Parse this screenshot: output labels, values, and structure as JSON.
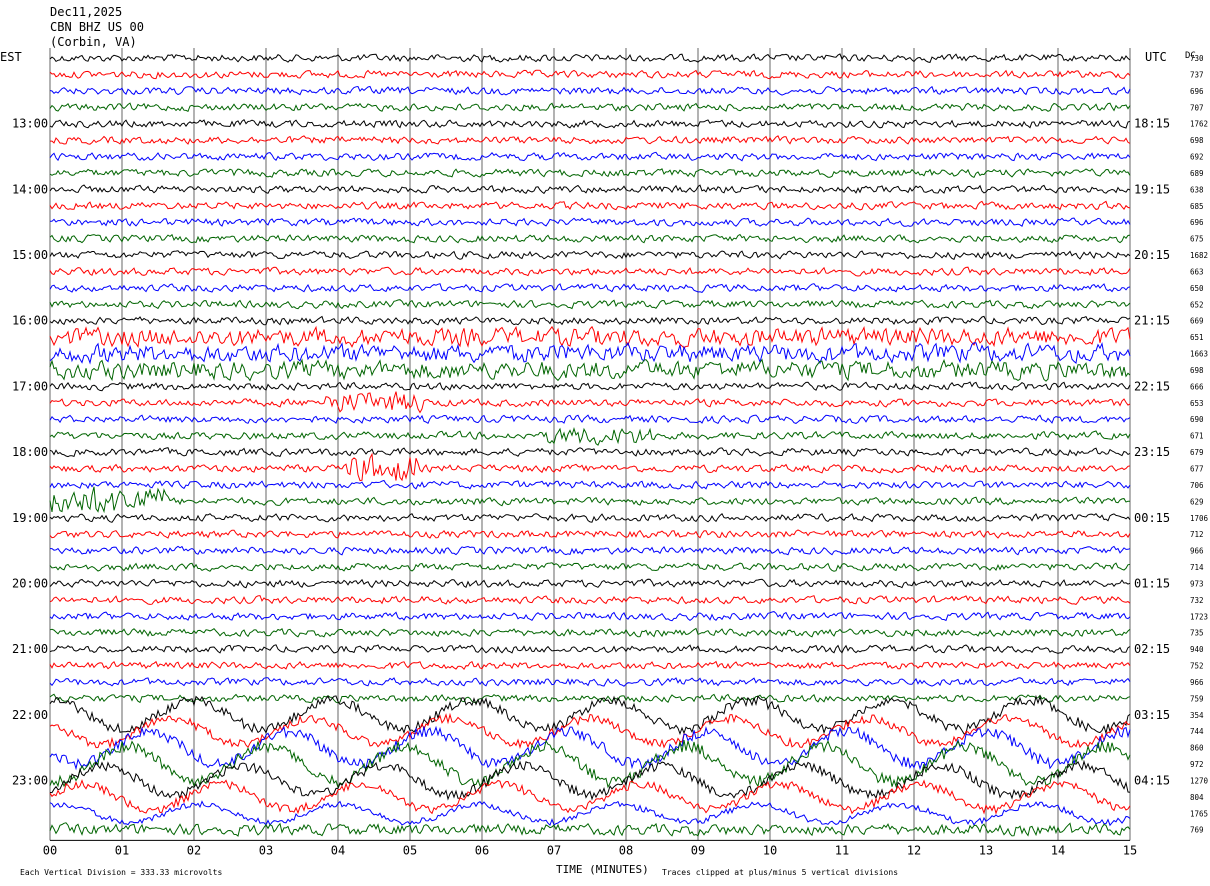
{
  "header": {
    "date": "Dec11,2025",
    "station": "CBN BHZ US 00",
    "location": "(Corbin, VA)"
  },
  "left_axis_label": "EST",
  "right_axis_label": "UTC",
  "dc_label": "DC",
  "footer": {
    "scale_note": "Each Vertical Division =  333.33 microvolts",
    "x_label": "TIME (MINUTES)",
    "clip_note": "Traces clipped at plus/minus 5 vertical divisions"
  },
  "colors": {
    "trace_cycle": [
      "#000000",
      "#ff0000",
      "#0000ff",
      "#006400"
    ],
    "grid": "#000000"
  },
  "chart_data": {
    "type": "line",
    "title": "CBN BHZ US 00 (Corbin, VA) Dec11,2025",
    "xlabel": "TIME (MINUTES)",
    "x_ticks": [
      "00",
      "01",
      "02",
      "03",
      "04",
      "05",
      "06",
      "07",
      "08",
      "09",
      "10",
      "11",
      "12",
      "13",
      "14",
      "15"
    ],
    "xlim": [
      0,
      15
    ],
    "rows_per_hour": 4,
    "left_hour_labels": [
      "13:00",
      "14:00",
      "15:00",
      "16:00",
      "17:00",
      "18:00",
      "19:00",
      "20:00",
      "21:00",
      "22:00",
      "23:00"
    ],
    "right_hour_labels": [
      "18:15",
      "19:15",
      "20:15",
      "21:15",
      "22:15",
      "23:15",
      "00:15",
      "01:15",
      "02:15",
      "03:15",
      "04:15"
    ],
    "hour_label_first_row": 4,
    "dc_offsets": [
      "730",
      "737",
      "696",
      "707",
      "1762",
      "698",
      "692",
      "689",
      "638",
      "685",
      "696",
      "675",
      "1682",
      "663",
      "650",
      "652",
      "669",
      "651",
      "1663",
      "698",
      "666",
      "653",
      "690",
      "671",
      "679",
      "677",
      "706",
      "629",
      "1706",
      "712",
      "966",
      "714",
      "973",
      "732",
      "1723",
      "735",
      "940",
      "752",
      "966",
      "759",
      "354",
      "744",
      "860",
      "972",
      "1270",
      "804",
      "1765",
      "769"
    ],
    "trace_amplitude": [
      4,
      4,
      4,
      4,
      4,
      4,
      4,
      4,
      4,
      4,
      4,
      4,
      4,
      4,
      4,
      4,
      4,
      4,
      4,
      4,
      4,
      4,
      4,
      4,
      4,
      4,
      4,
      4,
      4,
      4,
      4,
      4,
      4,
      4,
      4,
      4,
      4,
      4,
      4,
      4,
      16,
      14,
      18,
      20,
      16,
      14,
      10,
      6
    ],
    "events": [
      {
        "row": 17,
        "x_min": 0,
        "x_max": 15,
        "gain": 2.5
      },
      {
        "row": 18,
        "x_min": 0,
        "x_max": 15,
        "gain": 2.5
      },
      {
        "row": 19,
        "x_min": 0,
        "x_max": 15,
        "gain": 2.5
      },
      {
        "row": 21,
        "x_min": 3.8,
        "x_max": 5.2,
        "gain": 3
      },
      {
        "row": 23,
        "x_min": 6.9,
        "x_max": 8.4,
        "gain": 2.5
      },
      {
        "row": 25,
        "x_min": 4.1,
        "x_max": 5.1,
        "gain": 4
      },
      {
        "row": 27,
        "x_min": 0.0,
        "x_max": 1.6,
        "gain": 4
      }
    ]
  }
}
